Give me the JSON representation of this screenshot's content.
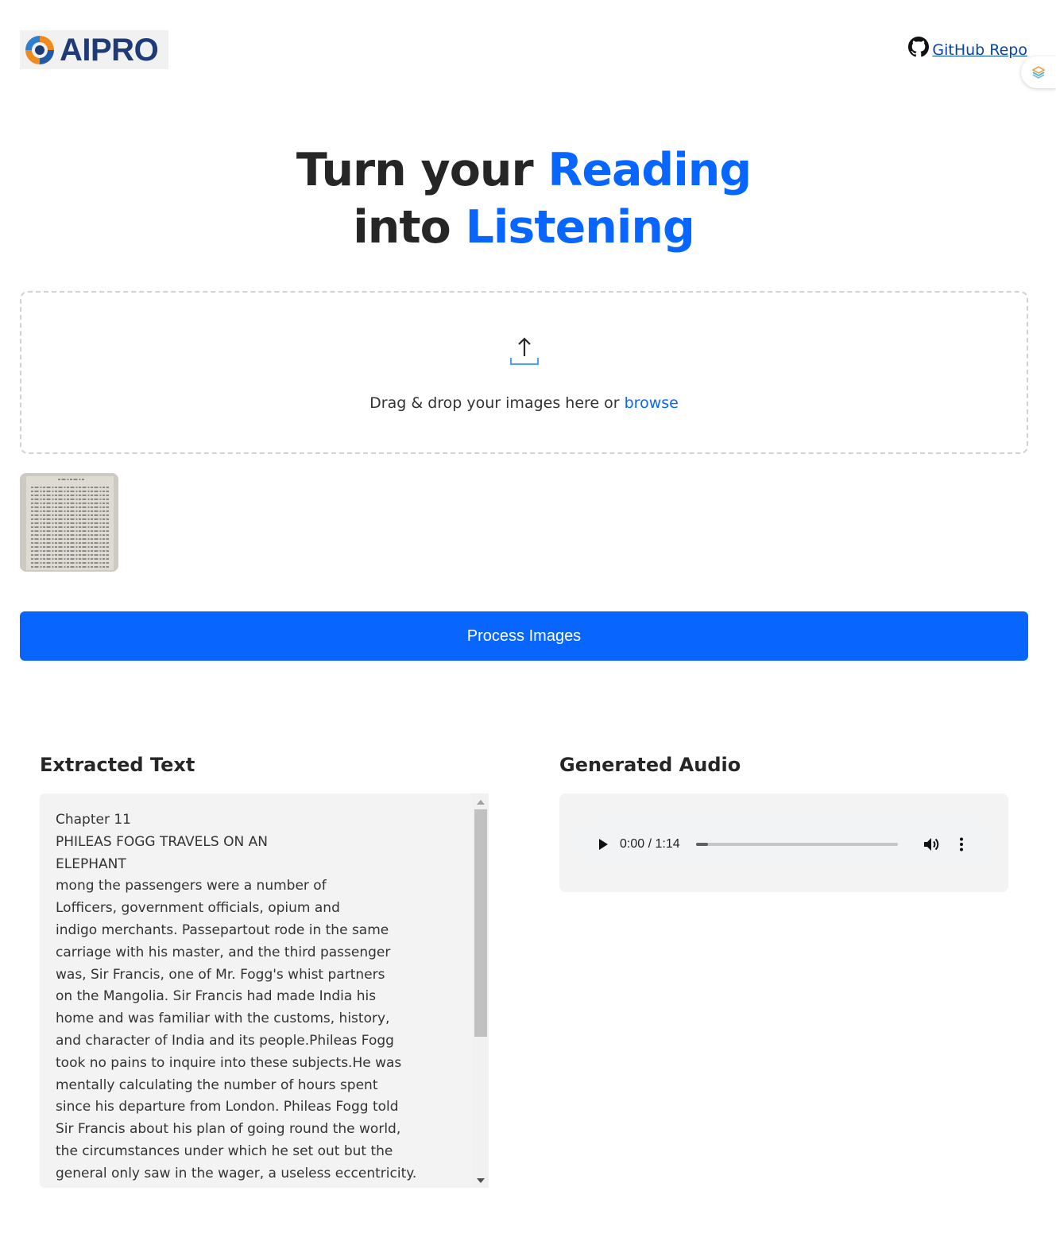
{
  "header": {
    "logo_text": "AIPRO",
    "github_label": " GitHub Repo"
  },
  "hero": {
    "line1_plain": "Turn your ",
    "line1_accent": "Reading",
    "line2_plain": "into ",
    "line2_accent": "Listening"
  },
  "dropzone": {
    "text": "Drag & drop your images here or ",
    "browse_label": "browse"
  },
  "process_button": {
    "label": "Process Images"
  },
  "extracted": {
    "title": "Extracted Text",
    "text": "Chapter 11\nPHILEAS FOGG TRAVELS ON AN\nELEPHANT\nmong the passengers were a number of\nLofficers, government officials, opium and\nindigo merchants. Passepartout rode in the same\ncarriage with his master, and the third passenger\nwas, Sir Francis, one of Mr. Fogg's whist partners\non the Mangolia. Sir Francis had made India his\nhome and was familiar with the customs, history,\nand character of India and its people.Phileas Fogg\ntook no pains to inquire into these subjects.He was\nmentally calculating the number of hours spent\nsince his departure from London. Phileas Fogg told\nSir Francis about his plan of going round the world,\nthe circumstances under which he set out but the\ngeneral only saw in the wager, a useless eccentricity."
  },
  "audio": {
    "title": "Generated Audio",
    "time": "0:00 / 1:14",
    "progress_fraction": 0.06
  },
  "colors": {
    "accent": "#0866ff",
    "logo": "#1e3b78"
  },
  "icons": [
    "logo-icon",
    "github-icon",
    "extension-icon",
    "upload-icon",
    "play-icon",
    "volume-icon",
    "more-options-icon"
  ]
}
